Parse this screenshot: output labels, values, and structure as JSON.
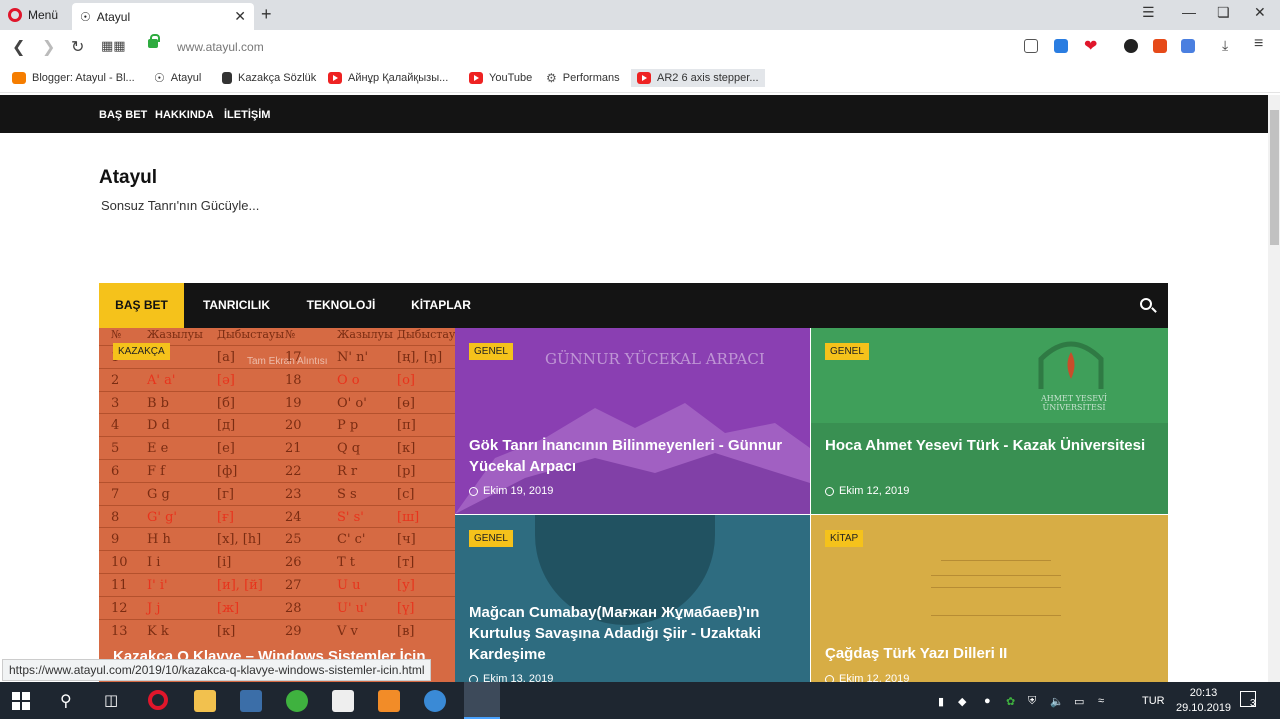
{
  "browser": {
    "menu_label": "Menü",
    "tab_title": "Atayul",
    "url": "www.atayul.com",
    "bookmarks": [
      {
        "label": "Blogger: Atayul - Bl...",
        "icon": "blogger-icon",
        "color": "#f57d00"
      },
      {
        "label": "Atayul",
        "icon": "atayul-icon",
        "color": "#333333"
      },
      {
        "label": "Kazakça Sözlük",
        "icon": "page-icon",
        "color": "#333333"
      },
      {
        "label": "Айнұр Қалайқызы...",
        "icon": "youtube-icon",
        "color": "#e22222"
      },
      {
        "label": "YouTube",
        "icon": "youtube-icon",
        "color": "#e22222"
      },
      {
        "label": "Performans",
        "icon": "performans-icon",
        "color": "#555555"
      },
      {
        "label": "AR2 6 axis stepper...",
        "icon": "youtube-icon",
        "color": "#e22222"
      }
    ],
    "status_url": "https://www.atayul.com/2019/10/kazakca-q-klavye-windows-sistemler-icin.html"
  },
  "site": {
    "top_nav": [
      "BAŞ BET",
      "HAKKINDA",
      "İLETİŞİM"
    ],
    "title": "Atayul",
    "tagline": "Sonsuz Tanrı'nın Gücüyle...",
    "main_nav": [
      "BAŞ BET",
      "TANRICILIK",
      "TEKNOLOJİ",
      "KİTAPLAR"
    ],
    "accent": "#f5c21b"
  },
  "posts": [
    {
      "badge": "KAZAKÇA",
      "title": "Kazakça Q Klavye – Windows Sistemler İçin",
      "date": ""
    },
    {
      "badge": "GENEL",
      "title": "Gök Tanrı İnancının Bilinmeyenleri - Günnur Yücekal Arpacı",
      "date": "Ekim 19, 2019",
      "image_text": "GÜNNUR YÜCEKAL ARPACI"
    },
    {
      "badge": "GENEL",
      "title": "Hoca Ahmet Yesevi Türk - Kazak Üniversitesi",
      "date": "Ekim 12, 2019",
      "image_text": "AHMET YESEVİ ÜNİVERSİTESİ"
    },
    {
      "badge": "GENEL",
      "title": "Mağcan Cumabay(Мағжан Жұмабаев)'ın Kurtuluş Savaşına Adadığı Şiir - Uzaktaki Kardeşime",
      "date": "Ekim 13, 2019"
    },
    {
      "badge": "KİTAP",
      "title": "Çağdaş Türk Yazı Dilleri II",
      "date": "Ekim 12, 2019"
    }
  ],
  "alphabet_table": {
    "headers": [
      "№",
      "Жазылуы",
      "Дыбыстауы",
      "№",
      "Жазылуы",
      "Дыбыстауы"
    ],
    "tooltip": "Tam Ekran Alıntısı",
    "rows": [
      [
        "1",
        "",
        "[a]",
        "17",
        "N' n'",
        "[ң], [ŋ]"
      ],
      [
        "2",
        "A' a'",
        "[ә]",
        "18",
        "O o",
        "[о]"
      ],
      [
        "3",
        "B b",
        "[б]",
        "19",
        "O' o'",
        "[ө]"
      ],
      [
        "4",
        "D d",
        "[д]",
        "20",
        "P p",
        "[п]"
      ],
      [
        "5",
        "E e",
        "[е]",
        "21",
        "Q q",
        "[к]"
      ],
      [
        "6",
        "F f",
        "[ф]",
        "22",
        "R r",
        "[р]"
      ],
      [
        "7",
        "G g",
        "[г]",
        "23",
        "S s",
        "[с]"
      ],
      [
        "8",
        "G' g'",
        "[ғ]",
        "24",
        "S' s'",
        "[ш]"
      ],
      [
        "9",
        "H h",
        "[x], [h]",
        "25",
        "C' c'",
        "[ч]"
      ],
      [
        "10",
        "I i",
        "[і]",
        "26",
        "T t",
        "[т]"
      ],
      [
        "11",
        "I' i'",
        "[и], [й]",
        "27",
        "U u",
        "[у]"
      ],
      [
        "12",
        "J j",
        "[ж]",
        "28",
        "U' u'",
        "[ү]"
      ],
      [
        "13",
        "K k",
        "[к]",
        "29",
        "V v",
        "[в]"
      ]
    ]
  },
  "taskbar": {
    "language": "TUR",
    "time": "20:13",
    "date": "29.10.2019",
    "notifications": "3"
  }
}
